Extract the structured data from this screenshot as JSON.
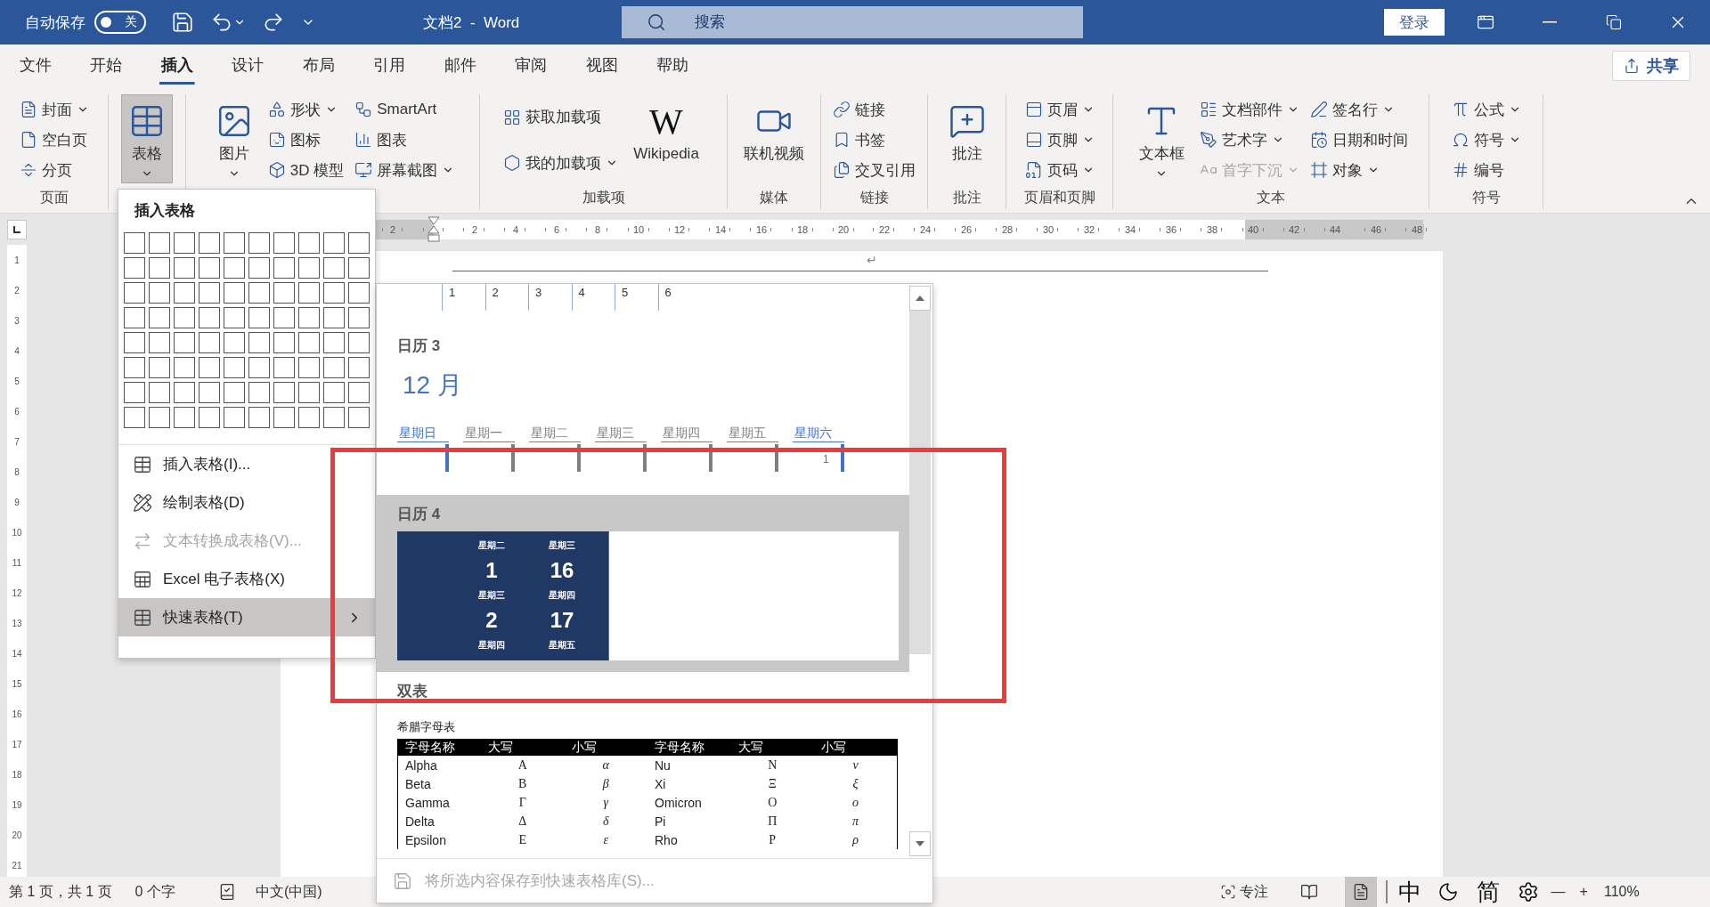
{
  "title_bar": {
    "autosave_label": "自动保存",
    "autosave": {
      "on": false,
      "label": "关"
    },
    "title": "文档2  -  Word",
    "search": {
      "placeholder": "搜索"
    },
    "sign_in": "登录"
  },
  "menu_tabs": [
    {
      "label": "文件",
      "selected": false
    },
    {
      "label": "开始",
      "selected": false
    },
    {
      "label": "插入",
      "selected": true
    },
    {
      "label": "设计",
      "selected": false
    },
    {
      "label": "布局",
      "selected": false
    },
    {
      "label": "引用",
      "selected": false
    },
    {
      "label": "邮件",
      "selected": false
    },
    {
      "label": "审阅",
      "selected": false
    },
    {
      "label": "视图",
      "selected": false
    },
    {
      "label": "帮助",
      "selected": false
    }
  ],
  "share": "共享",
  "ribbon": {
    "groups": [
      {
        "label": "页面",
        "columns": [
          [
            {
              "kind": "small",
              "label": "封面",
              "dropdown": true
            },
            {
              "kind": "small",
              "label": "空白页",
              "dropdown": false
            },
            {
              "kind": "small",
              "label": "分页",
              "dropdown": false
            }
          ]
        ]
      },
      {
        "columns": [
          [
            {
              "kind": "large",
              "label": "表格",
              "dropdown": true,
              "expanded": true
            }
          ]
        ]
      },
      {
        "columns": [
          [
            {
              "kind": "large",
              "label": "图片",
              "dropdown": true,
              "expanded": false
            }
          ],
          [
            {
              "kind": "small",
              "label": "形状",
              "dropdown": true
            },
            {
              "kind": "small",
              "label": "图标",
              "dropdown": false
            },
            {
              "kind": "small",
              "label": "3D 模型",
              "dropdown": false
            }
          ],
          [
            {
              "kind": "small",
              "label": "SmartArt",
              "dropdown": false
            },
            {
              "kind": "small",
              "label": "图表",
              "dropdown": false
            },
            {
              "kind": "small",
              "label": "屏幕截图",
              "dropdown": true
            }
          ]
        ]
      },
      {
        "label": "加载项",
        "columns": [
          [
            {
              "kind": "small",
              "label": "获取加载项",
              "dropdown": false
            },
            {
              "kind": "small",
              "label": "我的加载项",
              "dropdown": true
            }
          ],
          [
            {
              "kind": "large",
              "label": "Wikipedia",
              "logo": "W",
              "dropdown": false,
              "expanded": false
            }
          ]
        ]
      },
      {
        "label": "媒体",
        "columns": [
          [
            {
              "kind": "large",
              "label": "联机视频",
              "dropdown": false,
              "expanded": false
            }
          ]
        ]
      },
      {
        "label": "链接",
        "columns": [
          [
            {
              "kind": "small",
              "label": "链接",
              "dropdown": false
            },
            {
              "kind": "small",
              "label": "书签",
              "dropdown": false
            },
            {
              "kind": "small",
              "label": "交叉引用",
              "dropdown": false
            }
          ]
        ]
      },
      {
        "label": "批注",
        "columns": [
          [
            {
              "kind": "large",
              "label": "批注",
              "dropdown": false,
              "expanded": false
            }
          ]
        ]
      },
      {
        "label": "页眉和页脚",
        "columns": [
          [
            {
              "kind": "small",
              "label": "页眉",
              "dropdown": true
            },
            {
              "kind": "small",
              "label": "页脚",
              "dropdown": true
            },
            {
              "kind": "small",
              "label": "页码",
              "dropdown": true
            }
          ]
        ]
      },
      {
        "label": "文本",
        "columns": [
          [
            {
              "kind": "large",
              "label": "文本框",
              "dropdown": true,
              "expanded": false
            }
          ],
          [
            {
              "kind": "small",
              "label": "文档部件",
              "dropdown": true,
              "disabled": false
            },
            {
              "kind": "small",
              "label": "艺术字",
              "dropdown": true,
              "disabled": false
            },
            {
              "kind": "small",
              "label": "首字下沉",
              "dropdown": true,
              "disabled": true
            }
          ],
          [
            {
              "kind": "small",
              "label": "签名行",
              "dropdown": true
            },
            {
              "kind": "small",
              "label": "日期和时间",
              "dropdown": false
            },
            {
              "kind": "small",
              "label": "对象",
              "dropdown": true
            }
          ]
        ]
      },
      {
        "label": "符号",
        "columns": [
          [
            {
              "kind": "small",
              "label": "公式",
              "dropdown": true
            },
            {
              "kind": "small",
              "label": "符号",
              "dropdown": true
            },
            {
              "kind": "small",
              "label": "编号",
              "dropdown": false
            }
          ]
        ]
      }
    ]
  },
  "ruler": {
    "left_marks": [
      "2"
    ],
    "marks": [
      "2",
      "4",
      "6",
      "8",
      "10",
      "12",
      "14",
      "16",
      "18",
      "20",
      "22",
      "24",
      "26",
      "28",
      "30",
      "32",
      "34",
      "36",
      "38",
      "40",
      "42",
      "44",
      "46",
      "48"
    ]
  },
  "vertical_ruler": [
    "1",
    "2",
    "3",
    "4",
    "5",
    "6",
    "7",
    "8",
    "9",
    "10",
    "11",
    "12",
    "13",
    "14",
    "15",
    "16",
    "17",
    "18",
    "19",
    "20",
    "21"
  ],
  "document": {
    "paragraph_mark": "↵"
  },
  "insert_menu": {
    "title": "插入表格",
    "items": [
      {
        "label": "插入表格(I)...",
        "disabled": false,
        "selected": false,
        "submenu": false
      },
      {
        "label": "绘制表格(D)",
        "disabled": false,
        "selected": false,
        "submenu": false
      },
      {
        "label": "文本转换成表格(V)...",
        "disabled": true,
        "selected": false,
        "submenu": false
      },
      {
        "label": "Excel 电子表格(X)",
        "disabled": false,
        "selected": false,
        "submenu": false
      },
      {
        "label": "快速表格(T)",
        "disabled": false,
        "selected": true,
        "submenu": true
      }
    ]
  },
  "quick_tables": {
    "sections": [
      {
        "kind": "calendar_tail",
        "selected": false,
        "numbers": [
          "1",
          "2",
          "3",
          "4",
          "5",
          "6"
        ]
      },
      {
        "kind": "calendar_month",
        "selected": false,
        "title": "日历 3",
        "month": "12 月",
        "weekdays": [
          {
            "label": "星期日",
            "color": "#4472c4"
          },
          {
            "label": "星期一",
            "color": "#7f7f7f"
          },
          {
            "label": "星期二",
            "color": "#7f7f7f"
          },
          {
            "label": "星期三",
            "color": "#7f7f7f"
          },
          {
            "label": "星期四",
            "color": "#7f7f7f"
          },
          {
            "label": "星期五",
            "color": "#7f7f7f"
          },
          {
            "label": "星期六",
            "color": "#4472c4"
          }
        ],
        "first_day": "1"
      },
      {
        "kind": "calendar_tiles",
        "selected": true,
        "title": "日历 4",
        "rows": [
          {
            "kind": "weekday",
            "cells": [
              "星期二",
              "星期三"
            ]
          },
          {
            "kind": "date",
            "cells": [
              "1",
              "16"
            ]
          },
          {
            "kind": "weekday",
            "cells": [
              "星期三",
              "星期四"
            ]
          },
          {
            "kind": "date",
            "cells": [
              "2",
              "17"
            ]
          },
          {
            "kind": "weekday",
            "cells": [
              "星期四",
              "星期五"
            ]
          }
        ]
      },
      {
        "kind": "table",
        "selected": false,
        "title": "双表",
        "caption": "希腊字母表",
        "columns": [
          "字母名称",
          "大写",
          "小写",
          "字母名称",
          "大写",
          "小写"
        ],
        "rows": [
          [
            "Alpha",
            "Α",
            "α",
            "Nu",
            "Ν",
            "ν"
          ],
          [
            "Beta",
            "Β",
            "β",
            "Xi",
            "Ξ",
            "ξ"
          ],
          [
            "Gamma",
            "Γ",
            "γ",
            "Omicron",
            "Ο",
            "ο"
          ],
          [
            "Delta",
            "Δ",
            "δ",
            "Pi",
            "Π",
            "π"
          ],
          [
            "Epsilon",
            "Ε",
            "ε",
            "Rho",
            "Ρ",
            "ρ"
          ]
        ]
      }
    ],
    "footer": {
      "label": "将所选内容保存到快速表格库(S)...",
      "disabled": true
    }
  },
  "status_bar": {
    "page": "第 1 页，共 1 页",
    "words": "0 个字",
    "language": "中文(中国)",
    "focus": "专注",
    "views": [
      {
        "selected": false
      },
      {
        "selected": true
      }
    ],
    "ime": [
      "中",
      "简"
    ],
    "zoom_out": "—",
    "zoom_in": "+",
    "zoom": "110%"
  }
}
